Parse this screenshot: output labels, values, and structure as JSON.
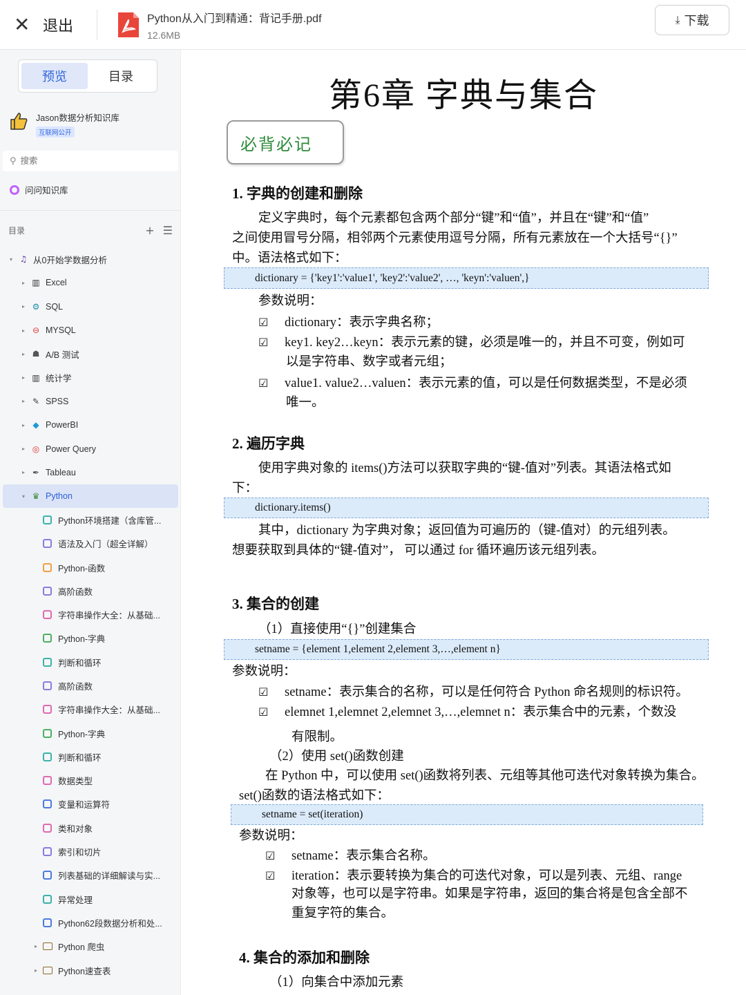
{
  "topbar": {
    "exit_label": "退出",
    "file_name": "Python从入门到精通：背记手册.pdf",
    "file_size": "12.6MB",
    "download_label": "下载"
  },
  "sidebar": {
    "tabs": [
      "预览",
      "目录"
    ],
    "knowledge_base": {
      "name": "Jason数据分析知识库",
      "badge": "互联网公开"
    },
    "search_placeholder": "搜索",
    "ask_label": "问问知识库",
    "toc_label": "目录",
    "tree": [
      {
        "label": "从0开始学数据分析",
        "level": 0,
        "arrow": "▾",
        "icon": "music-note-icon",
        "glyph": "♫",
        "color": "#5a3a9a"
      },
      {
        "label": "Excel",
        "level": 1,
        "arrow": "▸",
        "icon": "grid-icon",
        "glyph": "▥",
        "color": "#333"
      },
      {
        "label": "SQL",
        "level": 1,
        "arrow": "▸",
        "icon": "network-icon",
        "glyph": "⚙",
        "color": "#1f8ca8"
      },
      {
        "label": "MYSQL",
        "level": 1,
        "arrow": "▸",
        "icon": "no-entry-icon",
        "glyph": "⊖",
        "color": "#d93a3a"
      },
      {
        "label": "A/B 测试",
        "level": 1,
        "arrow": "▸",
        "icon": "person-icon",
        "glyph": "☗",
        "color": "#555"
      },
      {
        "label": "统计学",
        "level": 1,
        "arrow": "▸",
        "icon": "grid-icon",
        "glyph": "▥",
        "color": "#333"
      },
      {
        "label": "SPSS",
        "level": 1,
        "arrow": "▸",
        "icon": "wand-icon",
        "glyph": "✎",
        "color": "#444"
      },
      {
        "label": "PowerBI",
        "level": 1,
        "arrow": "▸",
        "icon": "gem-icon",
        "glyph": "◆",
        "color": "#1a9ad6"
      },
      {
        "label": "Power Query",
        "level": 1,
        "arrow": "▸",
        "icon": "target-icon",
        "glyph": "◎",
        "color": "#d9372f"
      },
      {
        "label": "Tableau",
        "level": 1,
        "arrow": "▸",
        "icon": "pen-icon",
        "glyph": "✒",
        "color": "#555"
      },
      {
        "label": "Python",
        "level": 1,
        "arrow": "▾",
        "icon": "python-icon",
        "glyph": "♛",
        "color": "#3a8a3a",
        "active": true
      },
      {
        "label": "Python环境搭建（含库管...",
        "level": 2,
        "doc": "#3ab3a8"
      },
      {
        "label": "语法及入门（超全详解）",
        "level": 2,
        "doc": "#8a7ae0"
      },
      {
        "label": "Python-函数",
        "level": 2,
        "doc": "#f0a040"
      },
      {
        "label": "高阶函数",
        "level": 2,
        "doc": "#8a7ae0"
      },
      {
        "label": "字符串操作大全：从基础...",
        "level": 2,
        "doc": "#e06ab0"
      },
      {
        "label": "Python-字典",
        "level": 2,
        "doc": "#4ab060"
      },
      {
        "label": "判断和循环",
        "level": 2,
        "doc": "#3ab3a8"
      },
      {
        "label": "高阶函数",
        "level": 2,
        "doc": "#8a7ae0"
      },
      {
        "label": "字符串操作大全：从基础...",
        "level": 2,
        "doc": "#e06ab0"
      },
      {
        "label": "Python-字典",
        "level": 2,
        "doc": "#4ab060"
      },
      {
        "label": "判断和循环",
        "level": 2,
        "doc": "#3ab3a8"
      },
      {
        "label": "数据类型",
        "level": 2,
        "doc": "#e06ab0"
      },
      {
        "label": "变量和运算符",
        "level": 2,
        "doc": "#4a7ae0"
      },
      {
        "label": "类和对象",
        "level": 2,
        "doc": "#e06ab0"
      },
      {
        "label": "索引和切片",
        "level": 2,
        "doc": "#8a7ae0"
      },
      {
        "label": "列表基础的详细解读与实...",
        "level": 2,
        "doc": "#4a7ae0"
      },
      {
        "label": "异常处理",
        "level": 2,
        "doc": "#3ab3a8"
      },
      {
        "label": "Python62段数据分析和处...",
        "level": 2,
        "doc": "#4a7ae0"
      },
      {
        "label": "Python 爬虫",
        "level": 2,
        "folder": true,
        "arrow": "▸"
      },
      {
        "label": "Python速查表",
        "level": 2,
        "folder": true,
        "arrow": "▸"
      }
    ]
  },
  "doc": {
    "chapter_title": "第6章 字典与集合",
    "must_label": "必背必记",
    "s1_heading": "1.  字典的创建和删除",
    "s1_p1": "定义字典时，每个元素都包含两个部分“键”和“值”，并且在“键”和“值”",
    "s1_p2": "之间使用冒号分隔，相邻两个元素使用逗号分隔，所有元素放在一个大括号“{}”",
    "s1_p3": "中。语法格式如下：",
    "s1_code": "dictionary = {'key1':'value1', 'key2':'value2',    …, 'keyn':'valuen',}",
    "s1_params": "参数说明：",
    "s1_b1": "dictionary：表示字典名称；",
    "s1_b2a": "key1. key2…keyn：表示元素的键，必须是唯一的，并且不可变，例如可",
    "s1_b2b": "以是字符串、数字或者元组；",
    "s1_b3a": "value1. value2…valuen：表示元素的值，可以是任何数据类型，不是必须",
    "s1_b3b": "唯一。",
    "s2_heading": "2.  遍历字典",
    "s2_p1": "使用字典对象的 items()方法可以获取字典的“键-值对”列表。其语法格式如",
    "s2_p2": "下：",
    "s2_code": "dictionary.items()",
    "s2_p3": "其中，dictionary 为字典对象；返回值为可遍历的（键-值对）的元组列表。",
    "s2_p4": "想要获取到具体的“键-值对”，  可以通过 for 循环遍历该元组列表。",
    "s3_heading": "3.  集合的创建",
    "s3_sub1": "（1）直接使用“{}”创建集合",
    "s3_code1": "setname = {element 1,element 2,element 3,…,element n}",
    "s3_params1": "参数说明：",
    "s3_b1": "setname：表示集合的名称，可以是任何符合  Python 命名规则的标识符。",
    "s3_b2a": "elemnet 1,elemnet 2,elemnet 3,…,elemnet n：表示集合中的元素，个数没",
    "s3_b2b": "有限制。",
    "s3_sub2": "（2）使用 set()函数创建",
    "s3_p1": "在 Python 中，可以使用 set()函数将列表、元组等其他可迭代对象转换为集合。",
    "s3_p2": "set()函数的语法格式如下：",
    "s3_code2": "setname = set(iteration)",
    "s3_params2": "参数说明：",
    "s3_b3": "setname：表示集合名称。",
    "s3_b4a": "iteration：表示要转换为集合的可迭代对象，可以是列表、元组、range",
    "s3_b4b": "对象等，也可以是字符串。如果是字符串，返回的集合将是包含全部不",
    "s3_b4c": "重复字符的集合。",
    "s4_heading": "4.  集合的添加和删除",
    "s4_sub1": "（1）向集合中添加元素",
    "check_glyph": "☑"
  }
}
